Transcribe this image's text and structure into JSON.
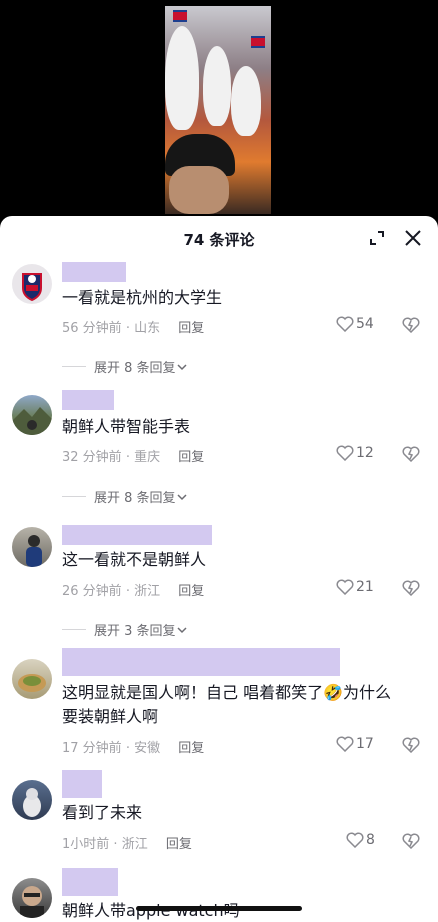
{
  "header": {
    "title": "74 条评论",
    "expand_icon": "expand-icon",
    "close_icon": "close-icon"
  },
  "comments": [
    {
      "text": "一看就是杭州的大学生",
      "time": "56 分钟前",
      "location": "山东",
      "reply": "回复",
      "likes": "54",
      "expand": "展开 8 条回复",
      "avatar": "football-club-badge"
    },
    {
      "text": "朝鲜人带智能手表",
      "time": "32 分钟前",
      "location": "重庆",
      "reply": "回复",
      "likes": "12",
      "expand": "展开 8 条回复",
      "avatar": "mountain-landscape"
    },
    {
      "text": "这一看就不是朝鲜人",
      "time": "26 分钟前",
      "location": "浙江",
      "reply": "回复",
      "likes": "21",
      "expand": "展开 3 条回复",
      "avatar": "person-photo"
    },
    {
      "text_line1": "这明显就是国人啊！自己 唱着都笑了",
      "emoji": "🤣",
      "text_line1_tail": "为什么",
      "text_line2": "要装朝鲜人啊",
      "time": "17 分钟前",
      "location": "安徽",
      "reply": "回复",
      "likes": "17",
      "avatar": "food-photo"
    },
    {
      "text": "看到了未来",
      "time": "1小时前",
      "location": "浙江",
      "reply": "回复",
      "likes": "8",
      "avatar": "cat-photo"
    },
    {
      "text": "朝鲜人带apple watch吗",
      "avatar": "person-with-glasses"
    }
  ],
  "colors": {
    "name_placeholder": "#d3c9f0",
    "meta": "#a1a1a6",
    "text": "#161823"
  }
}
